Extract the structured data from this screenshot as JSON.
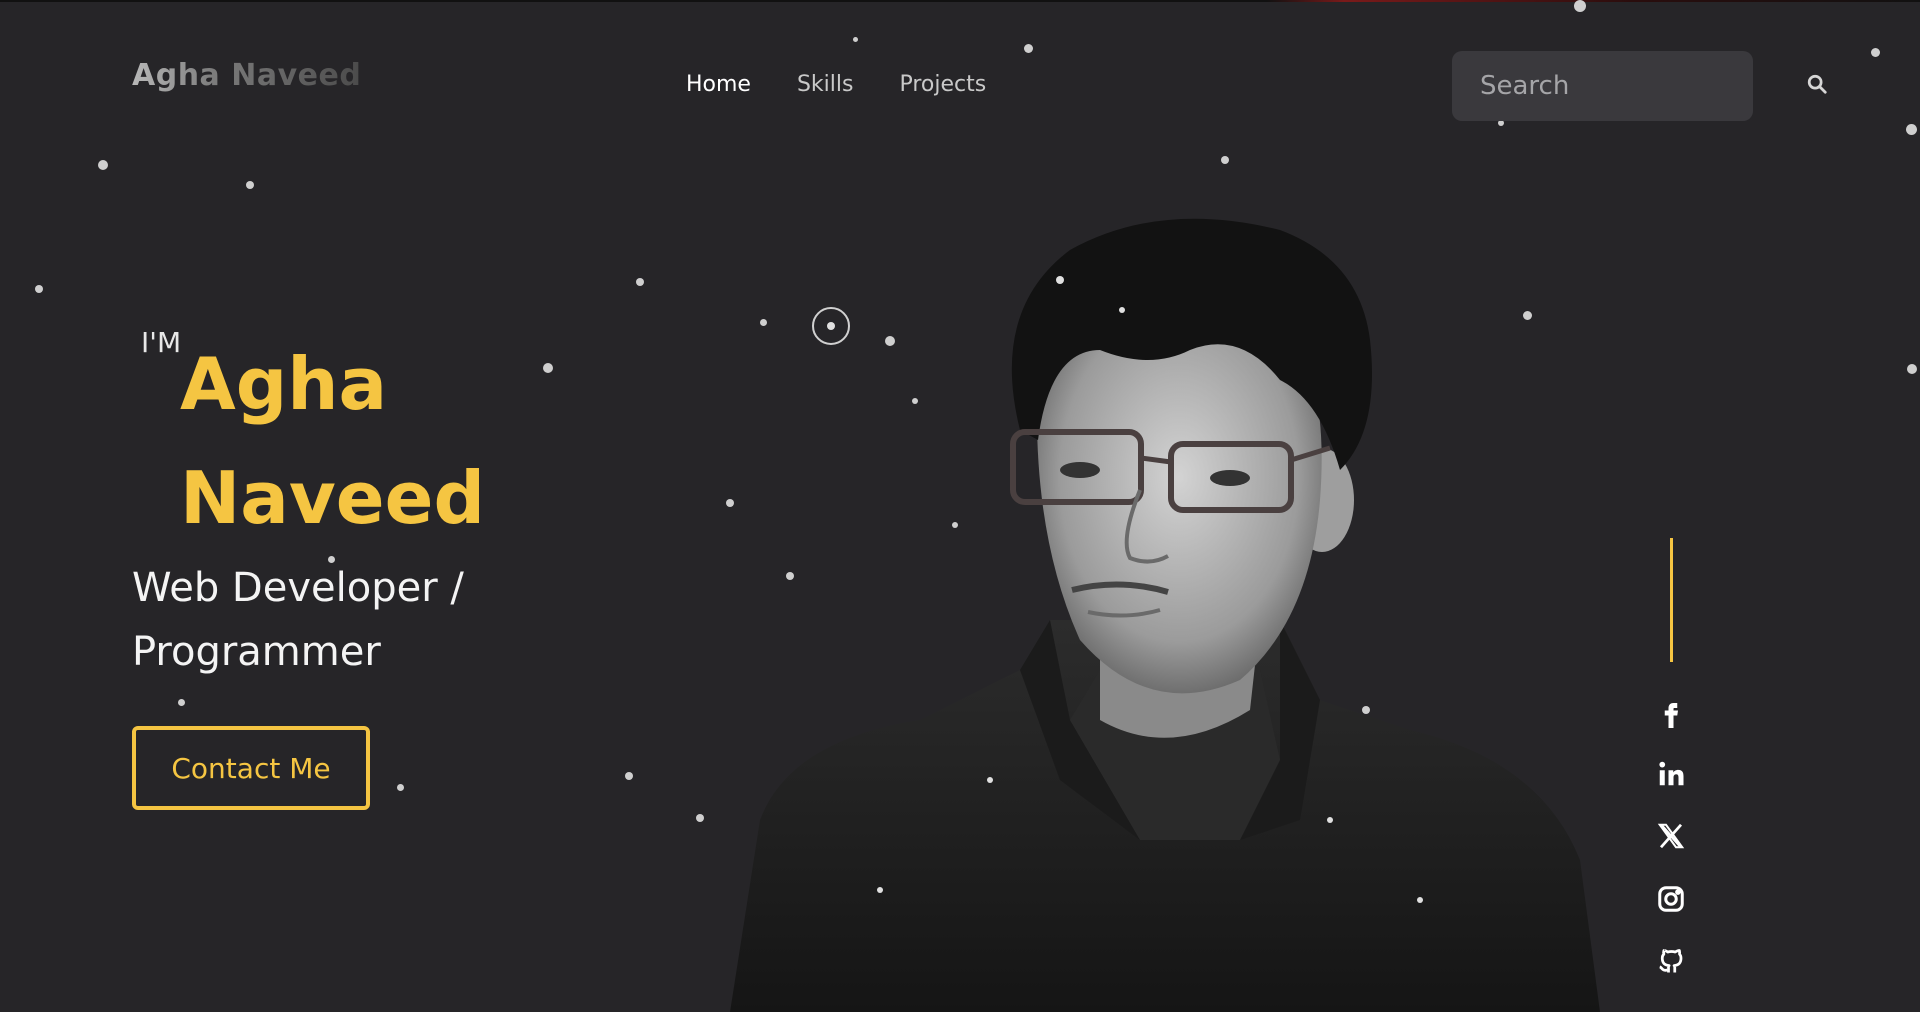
{
  "brand": {
    "logo_text": "Agha Naveed"
  },
  "nav": {
    "items": [
      {
        "label": "Home",
        "active": true
      },
      {
        "label": "Skills",
        "active": false
      },
      {
        "label": "Projects",
        "active": false
      }
    ]
  },
  "search": {
    "placeholder": "Search",
    "icon": "search-icon"
  },
  "hero": {
    "intro": "I'M",
    "name_first": "Agha",
    "name_last": "Naveed",
    "role": "Web Developer / Programmer",
    "cta_label": "Contact Me",
    "accent_color": "#f5c542"
  },
  "social": {
    "icons": [
      "facebook-icon",
      "linkedin-icon",
      "x-twitter-icon",
      "instagram-icon",
      "github-icon"
    ]
  },
  "colors": {
    "background": "#262528",
    "accent": "#f5c542",
    "text": "#ffffff"
  }
}
